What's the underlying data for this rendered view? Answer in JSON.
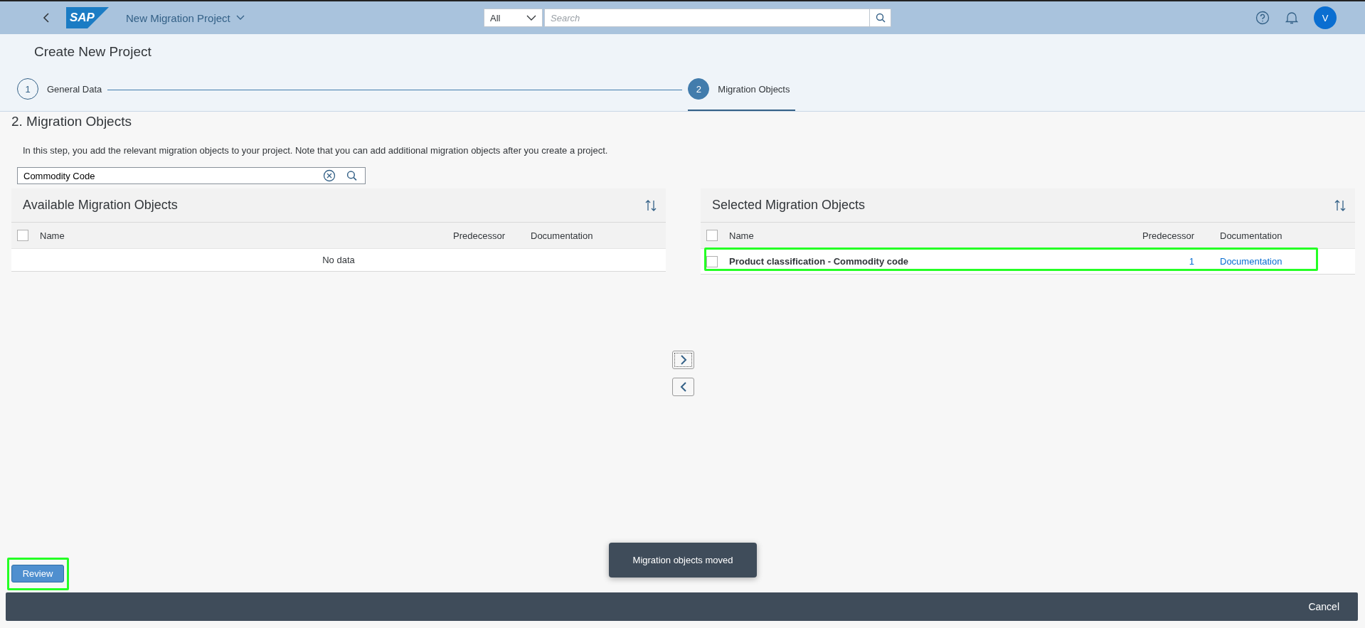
{
  "shell": {
    "logo_text": "SAP",
    "app_title": "New Migration Project",
    "search_scope": "All",
    "search_placeholder": "Search",
    "avatar_initial": "V"
  },
  "page_title": "Create New Project",
  "steps": [
    {
      "number": "1",
      "label": "General Data",
      "selected": false
    },
    {
      "number": "2",
      "label": "Migration Objects",
      "selected": true
    }
  ],
  "section": {
    "title": "2. Migration Objects",
    "description": "In this step, you add the relevant migration objects to your project. Note that you can add additional migration objects after you create a project.",
    "search_value": "Commodity Code"
  },
  "available": {
    "title": "Available Migration Objects",
    "columns": [
      "Name",
      "Predecessor",
      "Documentation"
    ],
    "no_data": "No data",
    "select_all": false
  },
  "selected_objects": {
    "title": "Selected Migration Objects",
    "columns": [
      "Name",
      "Predecessor",
      "Documentation"
    ],
    "select_all": false,
    "rows": [
      {
        "name": "Product classification - Commodity code",
        "predecessor": "1",
        "documentation": "Documentation",
        "checked": false,
        "highlighted": true
      }
    ]
  },
  "toast": "Migration objects moved",
  "footer": {
    "review": {
      "label": "Review",
      "highlighted": true
    },
    "cancel": "Cancel"
  }
}
